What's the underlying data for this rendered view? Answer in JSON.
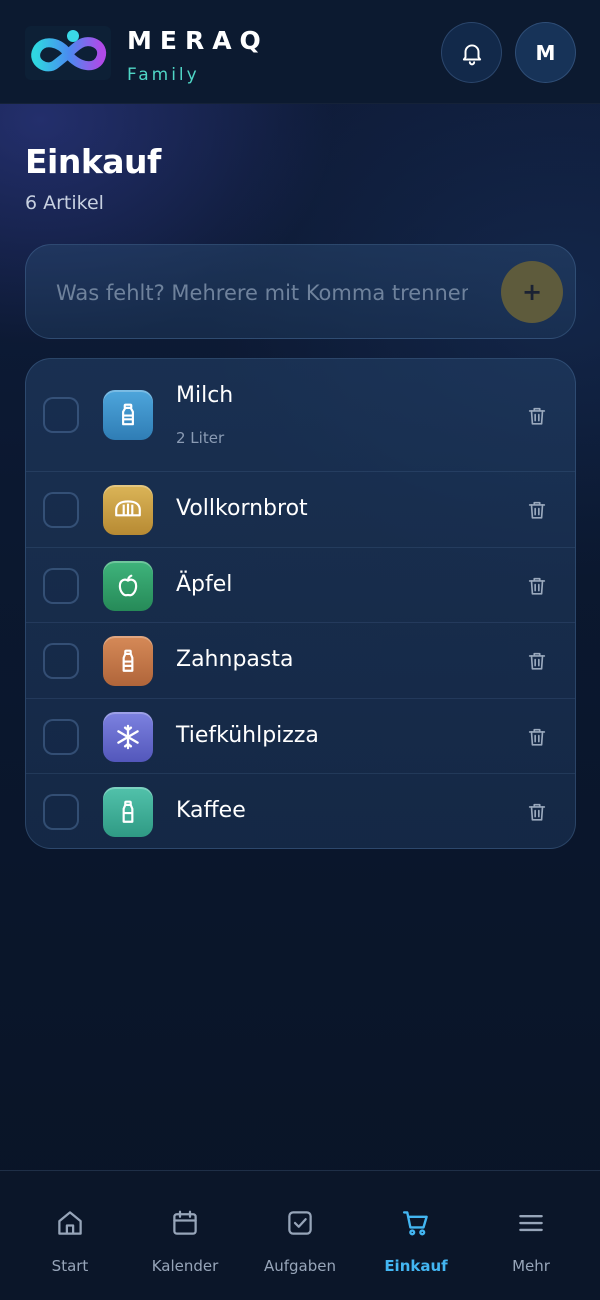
{
  "header": {
    "brand_name": "MERAQ",
    "brand_sub": "Family",
    "avatar_initial": "M",
    "icons": {
      "logo": "infinity-logo",
      "notifications": "bell-icon"
    }
  },
  "page": {
    "title": "Einkauf",
    "count": "6 Artikel"
  },
  "add_item": {
    "placeholder": "Was fehlt? Mehrere mit Komma trennen",
    "button_label": "+"
  },
  "items": [
    {
      "name": "Milch",
      "quantity": "2 Liter",
      "icon": "milk-bottle-icon",
      "color": "#3a90c9"
    },
    {
      "name": "Vollkornbrot",
      "quantity": "",
      "icon": "bread-icon",
      "color": "#c9a046"
    },
    {
      "name": "Äpfel",
      "quantity": "",
      "icon": "apple-icon",
      "color": "#2f9e6a"
    },
    {
      "name": "Zahnpasta",
      "quantity": "",
      "icon": "bottle-icon",
      "color": "#c5784a"
    },
    {
      "name": "Tiefkühlpizza",
      "quantity": "",
      "icon": "snowflake-icon",
      "color": "#6a6fd0"
    },
    {
      "name": "Kaffee",
      "quantity": "",
      "icon": "bottle-icon",
      "color": "#3fae98"
    }
  ],
  "nav": {
    "items": [
      {
        "label": "Start",
        "icon": "home-icon"
      },
      {
        "label": "Kalender",
        "icon": "calendar-icon"
      },
      {
        "label": "Aufgaben",
        "icon": "checkbox-icon"
      },
      {
        "label": "Einkauf",
        "icon": "cart-icon",
        "active": true
      },
      {
        "label": "Mehr",
        "icon": "menu-icon"
      }
    ]
  },
  "colors": {
    "accent": "#43b6f2",
    "brand_teal": "#4fd6c6",
    "add_button": "#5e5b3c"
  }
}
